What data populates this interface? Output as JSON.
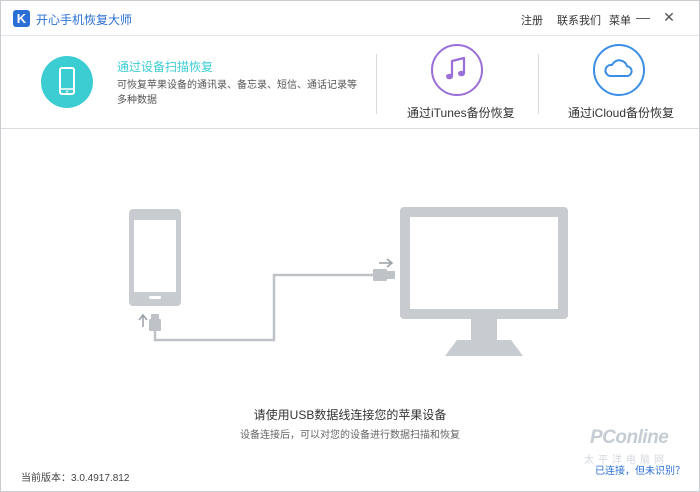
{
  "app": {
    "logo_letter": "K",
    "title": "开心手机恢复大师"
  },
  "titlebar": {
    "register": "注册",
    "contact": "联系我们",
    "menu": "菜单",
    "minimize_glyph": "—",
    "close_glyph": "✕"
  },
  "modes": {
    "usb": {
      "title": "通过设备扫描恢复",
      "description": "可恢复苹果设备的通讯录、备忘录、短信、通话记录等多种数据",
      "icon": "phone-icon",
      "accent": "#3ccdd3"
    },
    "itunes": {
      "label": "通过iTunes备份恢复",
      "icon": "music-note-icon",
      "accent": "#9b6fd8"
    },
    "icloud": {
      "label": "通过iCloud备份恢复",
      "icon": "cloud-icon",
      "accent": "#3a8ee6"
    }
  },
  "main": {
    "hint_title": "请使用USB数据线连接您的苹果设备",
    "hint_sub": "设备连接后，可以对您的设备进行数据扫描和恢复",
    "device_color": "#c8cbcf",
    "cable_color": "#bfc3c8"
  },
  "footer": {
    "version": "当前版本：3.0.4917.812",
    "help_link": "已连接，但未识别？",
    "watermark": "PConline",
    "watermark_sub": "太平洋电脑网"
  }
}
